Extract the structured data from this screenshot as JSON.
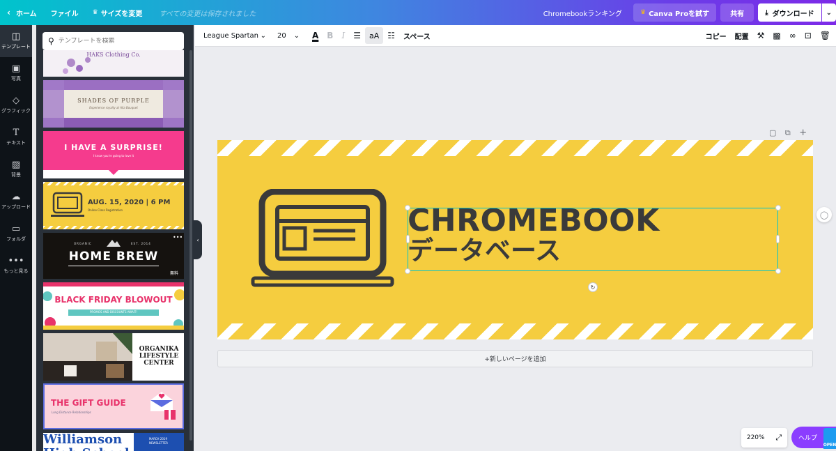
{
  "topbar": {
    "home": "ホーム",
    "file": "ファイル",
    "resize": "サイズを変更",
    "saved_status": "すべての変更は保存されました",
    "ranking_link": "Chromebookランキング",
    "pro_button": "Canva Proを試す",
    "share_button": "共有",
    "download_button": "ダウンロード"
  },
  "rail": {
    "items": [
      {
        "label": "テンプレート",
        "icon": "template-icon"
      },
      {
        "label": "写真",
        "icon": "photo-icon"
      },
      {
        "label": "グラフィック",
        "icon": "graphics-icon"
      },
      {
        "label": "テキスト",
        "icon": "text-icon"
      },
      {
        "label": "背景",
        "icon": "background-icon"
      },
      {
        "label": "アップロード",
        "icon": "upload-icon"
      },
      {
        "label": "フォルダ",
        "icon": "folder-icon"
      },
      {
        "label": "もっと見る",
        "icon": "more-icon"
      }
    ]
  },
  "panel": {
    "search_placeholder": "テンプレートを検索",
    "templates": [
      {
        "title": "HAKS Clothing Co.",
        "bg": "#f4f0f5",
        "color": "#7a4a9a"
      },
      {
        "title": "SHADES OF PURPLE",
        "subtitle": "Experience royalty at Alia Bouquet",
        "bg": "#efeae0",
        "color": "#6a5a4a"
      },
      {
        "title": "I HAVE A SURPRISE!",
        "subtitle": "I know you're going to love it",
        "bg": "#f53b8d",
        "color": "#ffffff"
      },
      {
        "title": "AUG. 15, 2020 | 6 PM",
        "subtitle": "Online Class Registration",
        "bg": "#f5cd3f",
        "color": "#3a3a3a"
      },
      {
        "title": "HOME BREW",
        "top_left": "ORGANIC",
        "top_right": "EST. 2014",
        "badge": "無料",
        "bg": "#15120f",
        "color": "#ffffff"
      },
      {
        "title": "BLACK FRIDAY BLOWOUT",
        "subtitle": "PROMOS AND DISCOUNTS AWAIT!",
        "bg": "#ffffff",
        "color": "#e8336b"
      },
      {
        "title": "ORGANIKA LIFESTYLE CENTER",
        "bg": "#ffffff",
        "color": "#1a1a1a"
      },
      {
        "title": "THE GIFT GUIDE",
        "subtitle": "Long Distance Relationships",
        "bg": "#fbd3dc",
        "color": "#e8336b"
      },
      {
        "title": "Williamson High School",
        "side": "MARCH 2019 NEWSLETTER",
        "bg": "#ffffff",
        "color": "#1d4fb0"
      }
    ]
  },
  "toolbar2": {
    "font": "League Spartan",
    "size": "20",
    "aa": "aA",
    "spacing": "スペース",
    "copy": "コピー",
    "arrange": "配置"
  },
  "design": {
    "title": "CHROMEBOOK",
    "subtitle": "データベース",
    "bg_color": "#f5cd3f",
    "text_color": "#3a3a3a",
    "icon": "laptop-icon"
  },
  "add_page": "+新しいページを追加",
  "zoom": "220%",
  "help": "ヘルプ",
  "open_badge": "OPEN"
}
